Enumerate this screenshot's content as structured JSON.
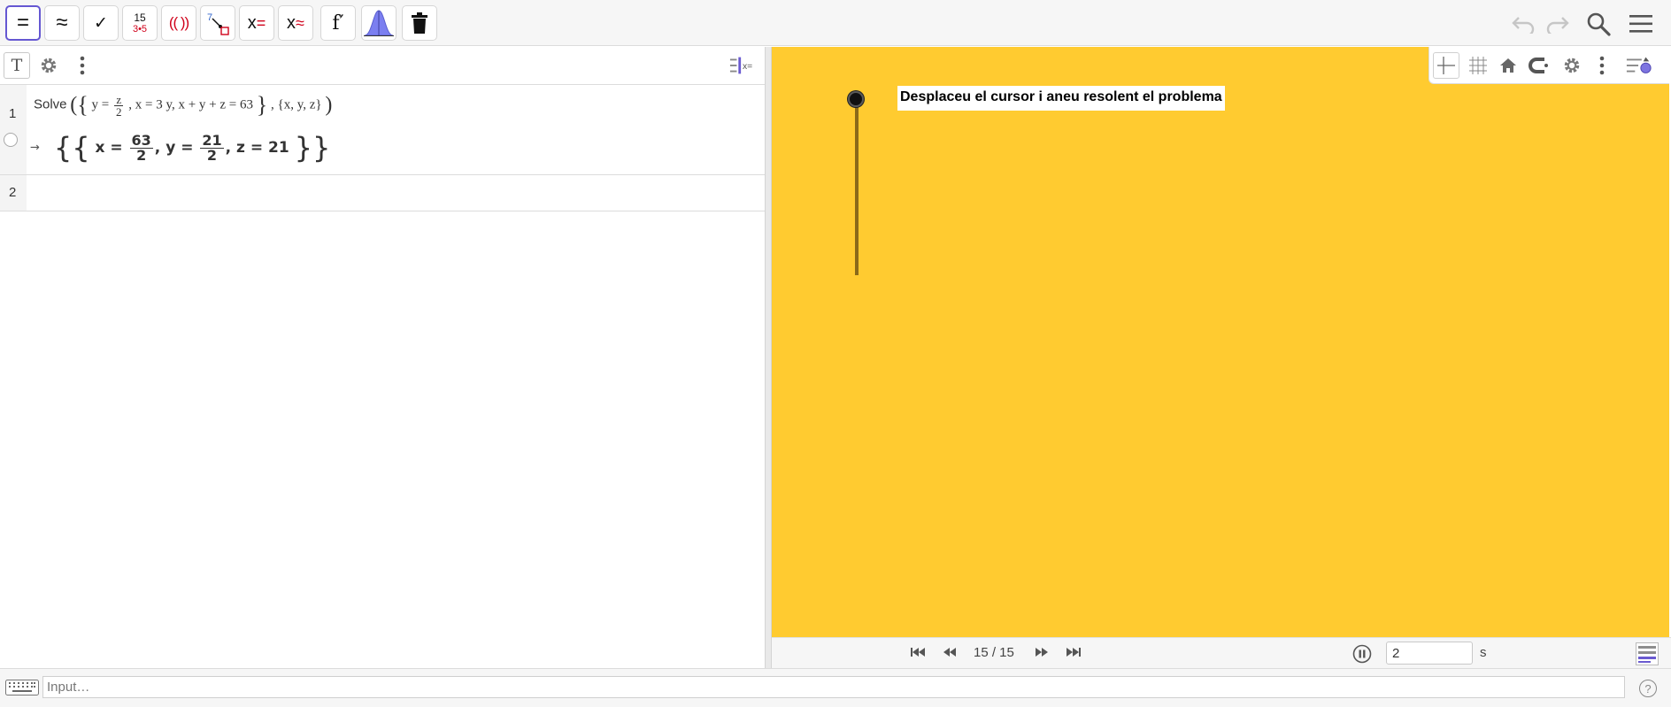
{
  "toolbar": {
    "tools": [
      {
        "name": "evaluate",
        "label": "=",
        "active": true
      },
      {
        "name": "numeric",
        "label": "≈",
        "active": false
      },
      {
        "name": "keep-input",
        "label": "✓",
        "active": false
      },
      {
        "name": "factor",
        "label_top": "15",
        "label_bottom": "3•5",
        "active": false
      },
      {
        "name": "expand",
        "label": "(( ))",
        "active": false
      },
      {
        "name": "substitute",
        "label": "7",
        "active": false
      },
      {
        "name": "solve",
        "label": "x",
        "suffix": "=",
        "active": false
      },
      {
        "name": "solve-numerically",
        "label": "x",
        "suffix": "≈",
        "active": false
      },
      {
        "name": "derivative",
        "label": "f′",
        "active": false
      },
      {
        "name": "probability",
        "label": "",
        "active": false
      },
      {
        "name": "delete",
        "label": "",
        "active": false
      }
    ]
  },
  "cas": {
    "rows": [
      {
        "number": "1",
        "input": {
          "command": "Solve",
          "eq1_lhs": "y =",
          "eq1_num": "z",
          "eq1_den": "2",
          "eq2": "x = 3 y, x + y + z = 63",
          "vars": "{x, y, z}"
        },
        "output": {
          "arrow": "→",
          "x_lhs": "x =",
          "x_num": "63",
          "x_den": "2",
          "y_lhs": "y =",
          "y_num": "21",
          "y_den": "2",
          "z_part": "z = 21"
        }
      },
      {
        "number": "2"
      }
    ]
  },
  "graphics": {
    "text_label": "Desplaceu el cursor i aneu resolent el problema",
    "slider_value": 15,
    "slider_max": 15
  },
  "animation": {
    "frame": "15 / 15",
    "step_value": "2",
    "unit": "s"
  },
  "input_bar": {
    "placeholder": "Input…",
    "help": "?"
  },
  "colors": {
    "graphics_bg": "#ffcb30",
    "active_tool": "#6557d2",
    "accent_red": "#d0021b"
  }
}
